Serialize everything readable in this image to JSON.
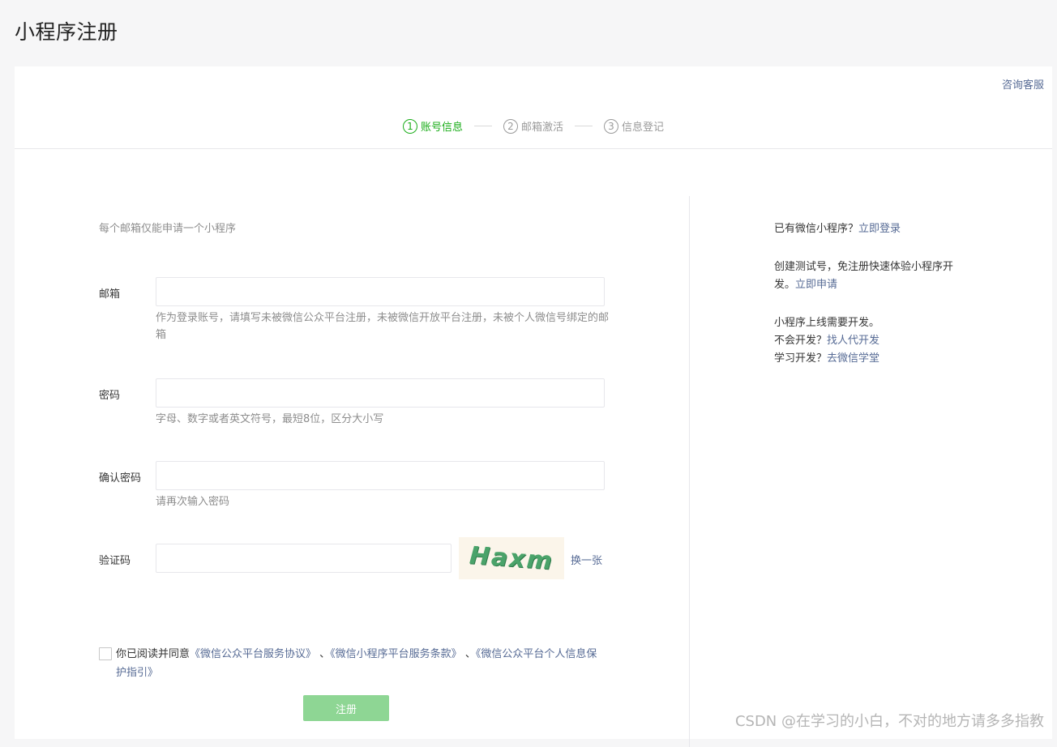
{
  "page_title": "小程序注册",
  "help_link": "咨询客服",
  "steps": [
    {
      "num": "1",
      "label": "账号信息",
      "active": true
    },
    {
      "num": "2",
      "label": "邮箱激活",
      "active": false
    },
    {
      "num": "3",
      "label": "信息登记",
      "active": false
    }
  ],
  "form": {
    "tip": "每个邮箱仅能申请一个小程序",
    "email": {
      "label": "邮箱",
      "value": "",
      "hint": "作为登录账号，请填写未被微信公众平台注册，未被微信开放平台注册，未被个人微信号绑定的邮箱"
    },
    "password": {
      "label": "密码",
      "value": "",
      "hint": "字母、数字或者英文符号，最短8位，区分大小写"
    },
    "confirm_password": {
      "label": "确认密码",
      "value": "",
      "hint": "请再次输入密码"
    },
    "captcha": {
      "label": "验证码",
      "value": "",
      "image_text": "Haxm",
      "refresh": "换一张"
    },
    "agreement": {
      "checked": false,
      "prefix": "你已阅读并同意",
      "link1": "《微信公众平台服务协议》",
      "sep1": " 、",
      "link2": "《微信小程序平台服务条款》",
      "sep2": " 、",
      "link3": "《微信公众平台个人信息保护指引》"
    },
    "submit": "注册"
  },
  "side": {
    "login_prefix": "已有微信小程序？",
    "login_link": "立即登录",
    "test_text": "创建测试号，免注册快速体验小程序开发。",
    "test_link": "立即申请",
    "dev_line": "小程序上线需要开发。",
    "dev_q1": "不会开发？",
    "dev_link1": "找人代开发",
    "dev_q2": "学习开发？",
    "dev_link2": "去微信学堂"
  },
  "watermark": "CSDN @在学习的小白，不对的地方请多多指教",
  "colors": {
    "active_step": "#1aad19",
    "link": "#576b95",
    "submit_disabled": "#8ed694"
  }
}
